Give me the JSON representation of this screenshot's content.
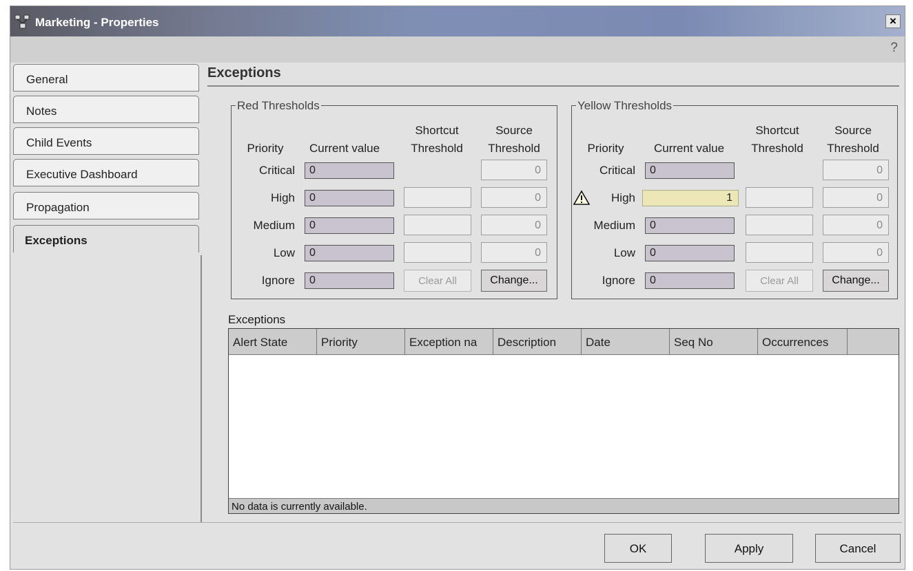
{
  "window": {
    "title": "Marketing - Properties",
    "close_label": "×",
    "help_label": "?"
  },
  "tabs": [
    {
      "label": "General"
    },
    {
      "label": "Notes"
    },
    {
      "label": "Child Events"
    },
    {
      "label": "Executive Dashboard"
    },
    {
      "label": "Propagation"
    },
    {
      "label": "Exceptions",
      "active": true
    }
  ],
  "section_title": "Exceptions",
  "columns": {
    "priority": "Priority",
    "current_value": "Current value",
    "shortcut_1": "Shortcut",
    "shortcut_2": "Threshold",
    "source_1": "Source",
    "source_2": "Threshold"
  },
  "red": {
    "legend": "Red Thresholds",
    "rows": [
      {
        "priority": "Critical",
        "current": "0",
        "source": "0"
      },
      {
        "priority": "High",
        "current": "0",
        "source": "0"
      },
      {
        "priority": "Medium",
        "current": "0",
        "source": "0"
      },
      {
        "priority": "Low",
        "current": "0",
        "source": "0"
      },
      {
        "priority": "Ignore",
        "current": "0"
      }
    ],
    "clear_all": "Clear All",
    "change": "Change..."
  },
  "yellow": {
    "legend": "Yellow Thresholds",
    "rows": [
      {
        "priority": "Critical",
        "current": "0",
        "source": "0"
      },
      {
        "priority": "High",
        "current": "1",
        "source": "0",
        "warning": true
      },
      {
        "priority": "Medium",
        "current": "0",
        "source": "0"
      },
      {
        "priority": "Low",
        "current": "0",
        "source": "0"
      },
      {
        "priority": "Ignore",
        "current": "0"
      }
    ],
    "clear_all": "Clear All",
    "change": "Change..."
  },
  "exceptions_table": {
    "label": "Exceptions",
    "headers": [
      "Alert State",
      "Priority",
      "Exception na",
      "Description",
      "Date",
      "Seq No",
      "Occurrences"
    ],
    "status": "No data is currently available."
  },
  "footer": {
    "ok": "OK",
    "apply": "Apply",
    "cancel": "Cancel"
  }
}
